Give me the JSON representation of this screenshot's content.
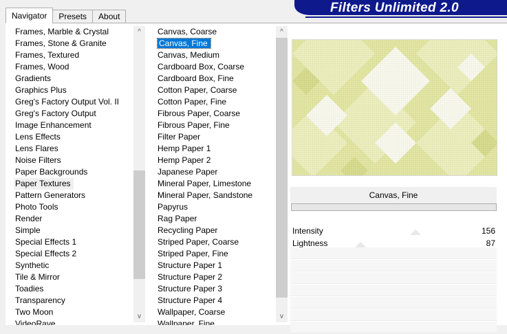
{
  "tabs": [
    "Navigator",
    "Presets",
    "About"
  ],
  "header": {
    "title": "Filters Unlimited 2.0"
  },
  "categories": [
    "Frames, Marble & Crystal",
    "Frames, Stone & Granite",
    "Frames, Textured",
    "Frames, Wood",
    "Gradients",
    "Graphics Plus",
    "Greg's Factory Output Vol. II",
    "Greg's Factory Output",
    "Image Enhancement",
    "Lens Effects",
    "Lens Flares",
    "Noise Filters",
    "Paper Backgrounds",
    "Paper Textures",
    "Pattern Generators",
    "Photo Tools",
    "Render",
    "Simple",
    "Special Effects 1",
    "Special Effects 2",
    "Synthetic",
    "Tile & Mirror",
    "Toadies",
    "Transparency",
    "Two Moon",
    "VideoRave"
  ],
  "selected_category": "Paper Textures",
  "filters": [
    "Canvas, Coarse",
    "Canvas, Fine",
    "Canvas, Medium",
    "Cardboard Box, Coarse",
    "Cardboard Box, Fine",
    "Cotton Paper, Coarse",
    "Cotton Paper, Fine",
    "Fibrous Paper, Coarse",
    "Fibrous Paper, Fine",
    "Filter Paper",
    "Hemp Paper 1",
    "Hemp Paper 2",
    "Japanese Paper",
    "Mineral Paper, Limestone",
    "Mineral Paper, Sandstone",
    "Papyrus",
    "Rag Paper",
    "Recycling Paper",
    "Striped Paper, Coarse",
    "Striped Paper, Fine",
    "Structure Paper 1",
    "Structure Paper 2",
    "Structure Paper 3",
    "Structure Paper 4",
    "Wallpaper, Coarse",
    "Wallpaper, Fine"
  ],
  "selected_filter": "Canvas, Fine",
  "filter_name": "Canvas, Fine",
  "params": [
    {
      "label": "Intensity",
      "value": "156"
    },
    {
      "label": "Lightness",
      "value": "87"
    }
  ],
  "scroll_glyphs": {
    "up": "^",
    "down": "v"
  },
  "colors": {
    "banner": "#0e1a8c",
    "selection": "#0078d7",
    "preview_base": "#dfe39e"
  }
}
